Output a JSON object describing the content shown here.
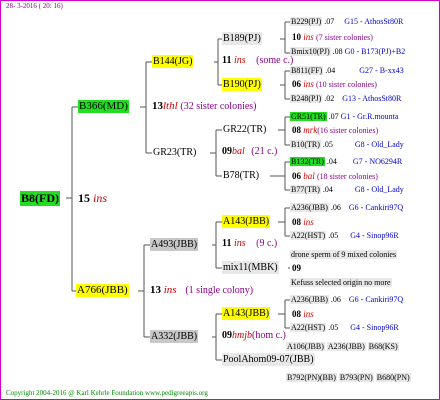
{
  "header": {
    "text": "28- 3-2016 ( 20: 16)"
  },
  "footer": {
    "text": "Copyright 2004-2016 @ Karl Kehrle Foundation   www.pedigreeapis.org"
  },
  "root": {
    "name": "B8(FD)",
    "count": "15",
    "ins": "ins"
  },
  "gen1": [
    {
      "name": "B366(MD)",
      "count": "13",
      "ins": "lthl",
      "note": "(32 sister colonies)"
    },
    {
      "name": "A766(JBB)",
      "count": "13",
      "ins": "ins",
      "note": "(1 single colony)"
    }
  ],
  "gen2": [
    {
      "name": "B144(JG)",
      "count": "11",
      "ins": "ins",
      "note": "(some c.)"
    },
    {
      "name": "GR23(TR)",
      "count": "09",
      "ins": "bal",
      "note": "(21 c.)"
    },
    {
      "name": "A493(JBB)",
      "count": "11",
      "ins": "ins",
      "note": "(9 c.)"
    },
    {
      "name": "A332(JBB)",
      "count": "09",
      "ins": "hmjb",
      "note": "(hom c.)"
    }
  ],
  "gen3": [
    {
      "name": "B189(PJ)",
      "count": "10",
      "ins": "ins",
      "note": "(7 sister colonies)"
    },
    {
      "name": "B190(PJ)",
      "count": "06",
      "ins": "ins",
      "note": "(10 sister colonies)"
    },
    {
      "name": "GR22(TR)",
      "count": "08",
      "ins": "mrk",
      "note": "(16 sister colonies)"
    },
    {
      "name": "B78(TR)",
      "count": "06",
      "ins": "bal",
      "note": "(18 sister colonies)"
    },
    {
      "name": "A143(JBB)",
      "count": "08",
      "ins": "ins",
      "note": ""
    },
    {
      "name": "mix11(MBK)",
      "count": "09",
      "ins": "",
      "note": ""
    },
    {
      "name": "A143(JBB)",
      "count": "08",
      "ins": "ins",
      "note": ""
    },
    {
      "name": "PoolAhom09-07(JBB)",
      "count": "",
      "ins": "",
      "note": ""
    }
  ],
  "gen4": [
    {
      "name": "B229(PJ)",
      "val": ".07",
      "info": "G15 - AthosSt80R"
    },
    {
      "name": "Bmix10(PJ)",
      "val": ".08",
      "info": "G0 - B173(PJ)+B2"
    },
    {
      "name": "B811(FF)",
      "val": ".04",
      "info": "G27 - B-xx43"
    },
    {
      "name": "B248(PJ)",
      "val": ".02",
      "info": "G13 - AthosSt80R"
    },
    {
      "name": "GR51(TR)",
      "val": ".07",
      "info": "G1 - Gr.R.mounta"
    },
    {
      "name": "B10(TR)",
      "val": ".05",
      "info": "G8 - Old_Lady"
    },
    {
      "name": "B132(TR)",
      "val": ".04",
      "info": "G7 - NO6294R"
    },
    {
      "name": "B77(TR)",
      "val": ".04",
      "info": "G8 - Old_Lady"
    },
    {
      "name": "A236(JBB)",
      "val": ".06",
      "info": "G6 - Cankiri97Q"
    },
    {
      "name": "A22(HST)",
      "val": ".05",
      "info": "G4 - Sinop96R"
    },
    {
      "name": "drone sperm of 9 mixed colonies",
      "val": "",
      "info": ""
    },
    {
      "name": "Kefuss selected origin no more",
      "val": "",
      "info": ""
    },
    {
      "name": "A236(JBB)",
      "val": ".06",
      "info": "G6 - Cankiri97Q"
    },
    {
      "name": "A22(HST)",
      "val": ".05",
      "info": "G4 - Sinop96R"
    },
    {
      "name": "A106(JBB)",
      "val": "A236(JBB)",
      "info": "B68(KS)"
    },
    {
      "name": "B792(PN)(BB)",
      "val": "B793(PN)",
      "info": "B680(PN)"
    }
  ]
}
